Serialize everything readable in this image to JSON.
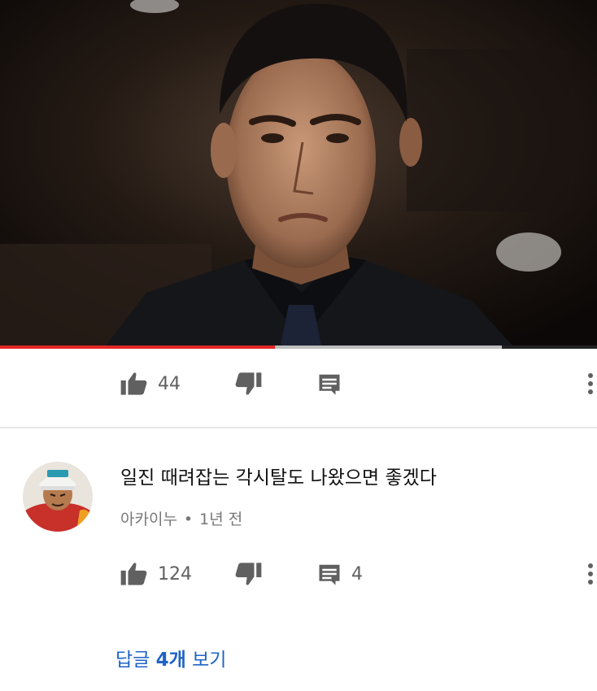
{
  "video": {
    "progress_fraction": 0.46,
    "buffered_fraction": 0.84
  },
  "video_actions": {
    "like_count": "44"
  },
  "comment": {
    "text": "일진 때려잡는 각시탈도 나왔으면 좋겠다",
    "author": "아카이누",
    "separator": "•",
    "time": "1년 전",
    "like_count": "124",
    "reply_count": "4",
    "replies_link": {
      "prefix": "답글 ",
      "count": "4개",
      "suffix": " 보기"
    }
  },
  "colors": {
    "progress": "#e32626",
    "link": "#1e63c8",
    "icon": "#606060"
  }
}
